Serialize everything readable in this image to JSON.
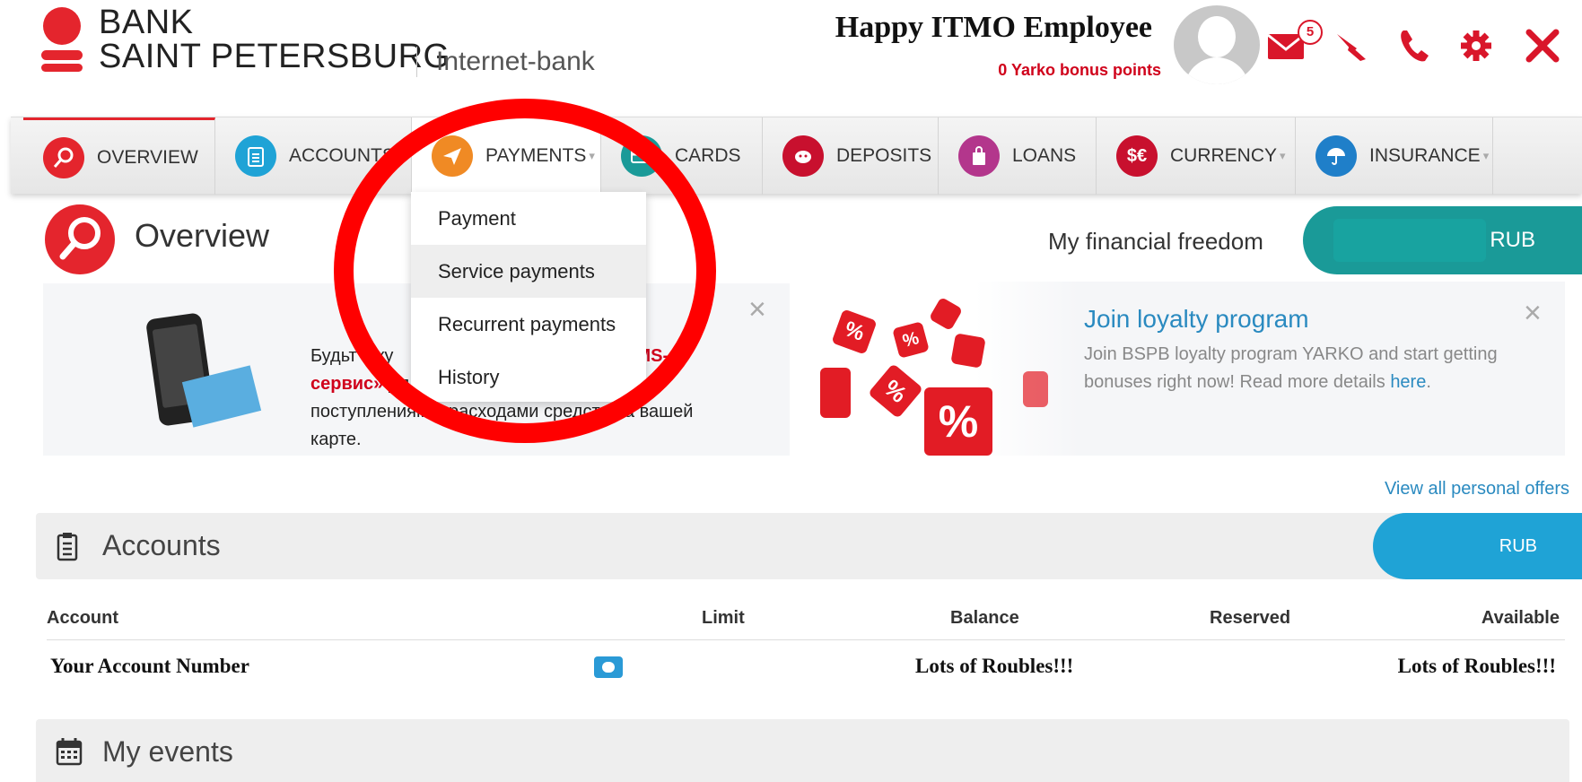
{
  "header": {
    "logo_line1": "BANK",
    "logo_line2": "SAINT PETERSBURG",
    "logo_subtitle": "Internet-bank",
    "user_name": "Happy ITMO Employee",
    "bonus_points": "0 Yarko bonus points",
    "mail_count": "5",
    "icons": [
      "mail-icon",
      "feedback-icon",
      "phone-icon",
      "settings-icon",
      "close-icon"
    ]
  },
  "nav": {
    "items": [
      {
        "label": "OVERVIEW",
        "icon": "magnifier-icon",
        "color": "#e4252d"
      },
      {
        "label": "ACCOUNTS",
        "icon": "clipboard-icon",
        "color": "#1fa3d6"
      },
      {
        "label": "PAYMENTS",
        "icon": "paper-plane-icon",
        "color": "#f08a24"
      },
      {
        "label": "CARDS",
        "icon": "card-icon",
        "color": "#1a9a98"
      },
      {
        "label": "DEPOSITS",
        "icon": "piggy-bank-icon",
        "color": "#c8102e"
      },
      {
        "label": "LOANS",
        "icon": "bag-icon",
        "color": "#b3368c"
      },
      {
        "label": "CURRENCY",
        "icon": "currency-icon",
        "color": "#c8102e"
      },
      {
        "label": "INSURANCE",
        "icon": "umbrella-icon",
        "color": "#1f7fc9"
      }
    ]
  },
  "payments_menu": {
    "items": [
      "Payment",
      "Service payments",
      "Recurrent payments",
      "History"
    ],
    "highlighted": "Service payments"
  },
  "overview": {
    "title": "Overview",
    "financial_freedom_label": "My financial freedom",
    "financial_freedom_currency": "RUB"
  },
  "sms_banner": {
    "line1_start": "Будьт",
    "line1_mid": " в ку",
    "line1_red": "MS-",
    "line2_red": "сервис»",
    "line2_rest": " дл",
    "line3": "поступлениям и расходами средств на вашей",
    "line4": "карте."
  },
  "loyalty_banner": {
    "title": "Join loyalty program",
    "text": "Join BSPB loyalty program YARKO and start getting bonuses right now! Read more details ",
    "link": "here",
    "after_link": "."
  },
  "offers_link": "View all personal offers",
  "accounts": {
    "title": "Accounts",
    "currency": "RUB",
    "columns": [
      "Account",
      "Limit",
      "Balance",
      "Reserved",
      "Available"
    ],
    "rows": [
      {
        "account": "Your Account Number",
        "balance": "Lots of Roubles!!!",
        "available": "Lots of Roubles!!!"
      }
    ]
  },
  "events": {
    "title": "My events"
  },
  "colors": {
    "brand_red": "#e4252d",
    "teal": "#1a9a98",
    "blue": "#1fa3d6",
    "annotation_red": "#ff0000"
  }
}
